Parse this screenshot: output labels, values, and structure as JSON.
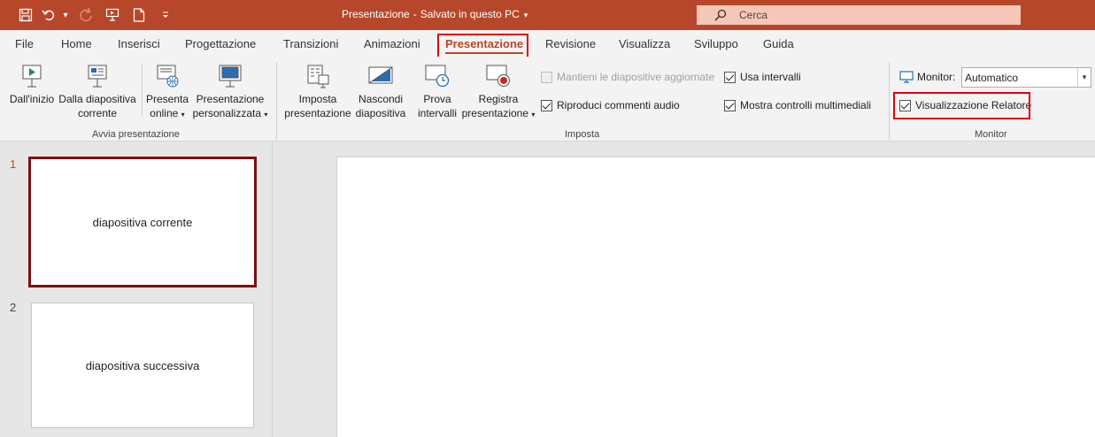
{
  "window": {
    "title": "Presentazione",
    "title_sep": "-",
    "save_status": "Salvato in questo PC",
    "search_placeholder": "Cerca"
  },
  "quick_access": [
    "save-icon",
    "undo-icon",
    "redo-icon",
    "start-presentation-icon",
    "new-file-icon",
    "customize-icon"
  ],
  "tabs": [
    {
      "label": "File"
    },
    {
      "label": "Home"
    },
    {
      "label": "Inserisci"
    },
    {
      "label": "Progettazione"
    },
    {
      "label": "Transizioni"
    },
    {
      "label": "Animazioni"
    },
    {
      "label": "Presentazione",
      "active": true
    },
    {
      "label": "Revisione"
    },
    {
      "label": "Visualizza"
    },
    {
      "label": "Sviluppo"
    },
    {
      "label": "Guida"
    }
  ],
  "ribbon": {
    "start_group": {
      "label": "Avvia presentazione",
      "buttons": [
        {
          "line1": "Dall'inizio",
          "line2": ""
        },
        {
          "line1": "Dalla diapositiva",
          "line2": "corrente"
        },
        {
          "line1": "Presenta",
          "line2": "online"
        },
        {
          "line1": "Presentazione",
          "line2": "personalizzata"
        }
      ]
    },
    "setup_group": {
      "label": "Imposta",
      "buttons": [
        {
          "line1": "Imposta",
          "line2": "presentazione"
        },
        {
          "line1": "Nascondi",
          "line2": "diapositiva"
        },
        {
          "line1": "Prova",
          "line2": "intervalli"
        },
        {
          "line1": "Registra",
          "line2": "presentazione"
        }
      ],
      "checkboxes": [
        {
          "label": "Mantieni le diapositive aggiornate",
          "checked": false,
          "disabled": true
        },
        {
          "label": "Riproduci commenti audio",
          "checked": true
        },
        {
          "label": "Usa intervalli",
          "checked": true
        },
        {
          "label": "Mostra controlli multimediali",
          "checked": true
        }
      ]
    },
    "monitor_group": {
      "label": "Monitor",
      "monitor_label": "Monitor:",
      "monitor_value": "Automatico",
      "presenter_view": {
        "label": "Visualizzazione Relatore",
        "checked": true
      }
    }
  },
  "slides": [
    {
      "number": "1",
      "text": "diapositiva corrente"
    },
    {
      "number": "2",
      "text": "diapositiva successiva"
    }
  ],
  "colors": {
    "accent": "#b7472a",
    "highlight_box": "#e0000f",
    "selected_thumb_border": "#7b1010"
  }
}
